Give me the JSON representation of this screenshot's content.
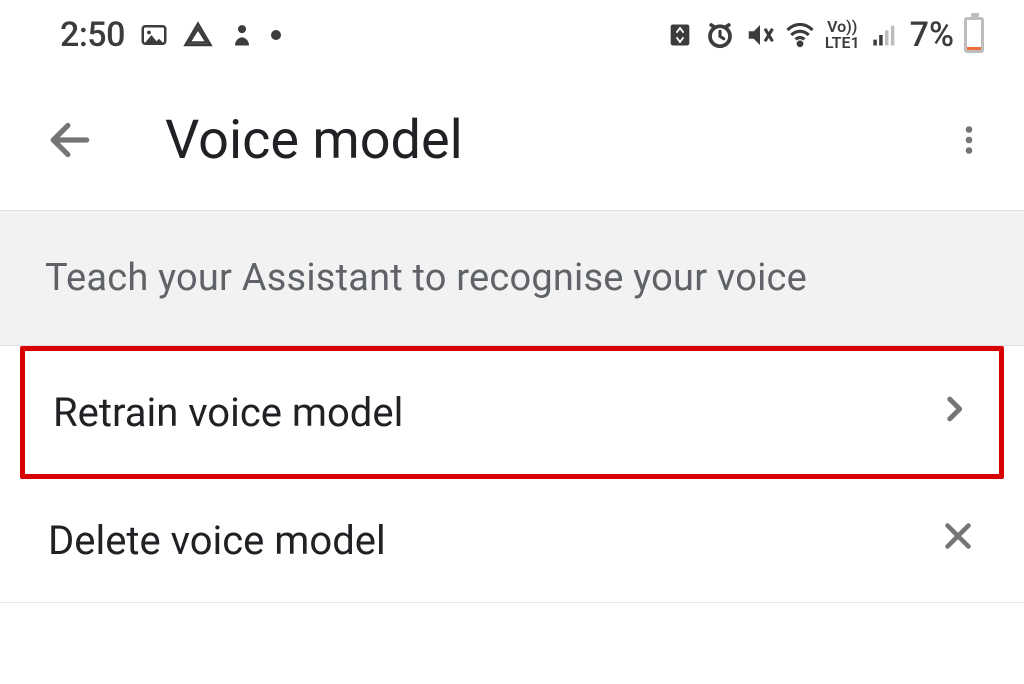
{
  "status": {
    "time": "2:50",
    "battery_percent": "7%"
  },
  "header": {
    "title": "Voice model"
  },
  "section": {
    "heading": "Teach your Assistant to recognise your voice"
  },
  "items": {
    "retrain": {
      "label": "Retrain voice model"
    },
    "delete": {
      "label": "Delete voice model"
    }
  }
}
